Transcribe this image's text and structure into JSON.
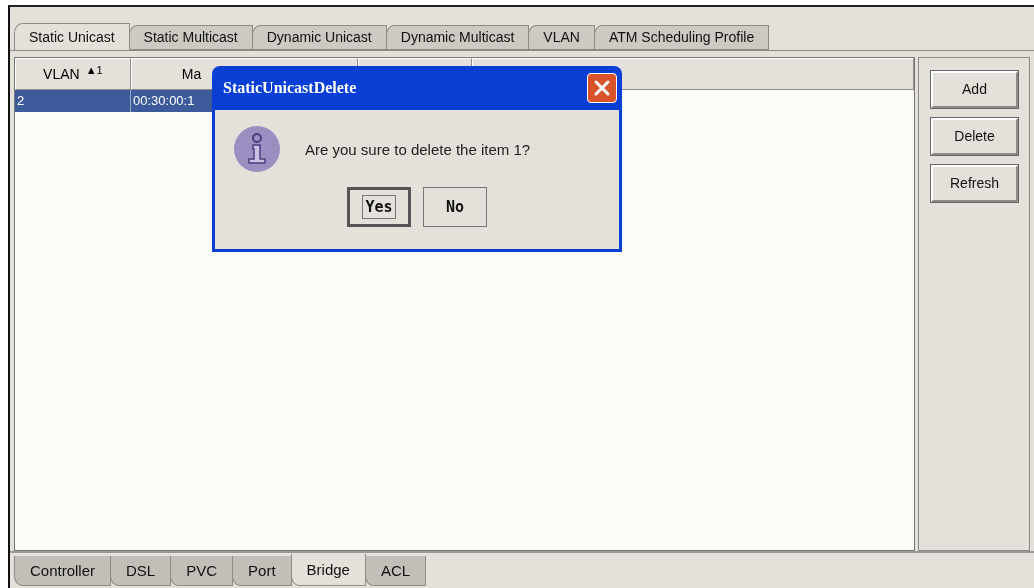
{
  "top_tabs": [
    {
      "label": "Static Unicast",
      "selected": true
    },
    {
      "label": "Static Multicast",
      "selected": false
    },
    {
      "label": "Dynamic Unicast",
      "selected": false
    },
    {
      "label": "Dynamic Multicast",
      "selected": false
    },
    {
      "label": "VLAN",
      "selected": false
    },
    {
      "label": "ATM Scheduling Profile",
      "selected": false
    }
  ],
  "table": {
    "columns": [
      {
        "label": "VLAN",
        "sort": "▲1"
      },
      {
        "label": "Ma"
      }
    ],
    "rows": [
      {
        "cells": [
          "2",
          "00:30:00:1"
        ],
        "selected": true
      }
    ]
  },
  "side_buttons": [
    "Add",
    "Delete",
    "Refresh"
  ],
  "dialog": {
    "title": "StaticUnicastDelete",
    "message": "Are you sure to delete the item 1?",
    "buttons": [
      {
        "label": "Yes",
        "focused": true
      },
      {
        "label": "No",
        "focused": false
      }
    ]
  },
  "bottom_tabs": [
    {
      "label": "Controller",
      "selected": false
    },
    {
      "label": "DSL",
      "selected": false
    },
    {
      "label": "PVC",
      "selected": false
    },
    {
      "label": "Port",
      "selected": false
    },
    {
      "label": "Bridge",
      "selected": true
    },
    {
      "label": "ACL",
      "selected": false
    }
  ]
}
